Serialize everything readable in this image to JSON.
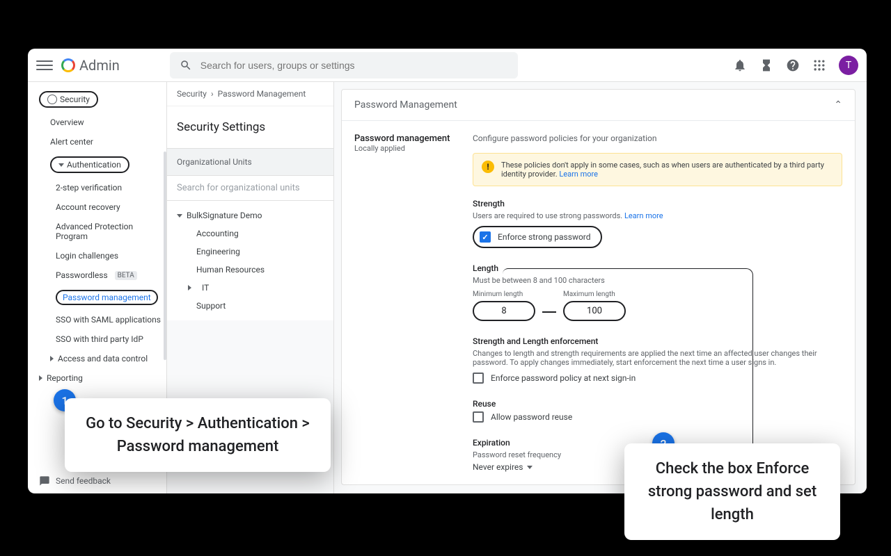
{
  "header": {
    "app_name": "Admin",
    "search_placeholder": "Search for users, groups or settings",
    "avatar_letter": "T"
  },
  "breadcrumb": {
    "root": "Security",
    "current": "Password Management"
  },
  "sidebar": {
    "security": "Security",
    "overview": "Overview",
    "alert_center": "Alert center",
    "authentication": "Authentication",
    "two_step": "2-step verification",
    "account_recovery": "Account recovery",
    "adv_protection": "Advanced Protection Program",
    "login_challenges": "Login challenges",
    "passwordless": "Passwordless",
    "beta": "BETA",
    "password_mgmt": "Password management",
    "sso_saml": "SSO with SAML applications",
    "sso_third": "SSO with third party IdP",
    "access_data": "Access and data control",
    "reporting": "Reporting",
    "send_feedback": "Send feedback"
  },
  "ou": {
    "title": "Security Settings",
    "header": "Organizational Units",
    "search": "Search for organizational units",
    "root": "BulkSignature Demo",
    "items": [
      "Accounting",
      "Engineering",
      "Human Resources",
      "IT",
      "Support"
    ]
  },
  "main": {
    "section": "Password Management",
    "card_title": "Password management",
    "card_sub": "Locally applied",
    "configure": "Configure password policies for your organization",
    "warning": "These policies don't apply in some cases, such as when users are authenticated by a third party identity provider.",
    "learn_more": "Learn more",
    "strength_title": "Strength",
    "strength_sub": "Users are required to use strong passwords.",
    "enforce_strong": "Enforce strong password",
    "length_title": "Length",
    "length_sub": "Must be between 8 and 100 characters",
    "min_label": "Minimum length",
    "max_label": "Maximum length",
    "min_val": "8",
    "max_val": "100",
    "sl_title": "Strength and Length enforcement",
    "sl_sub": "Changes to length and strength requirements are applied the next time an affected user changes their password. To apply changes immediately, start enforcement the next time a user signs in.",
    "enforce_signin": "Enforce password policy at next sign-in",
    "reuse_title": "Reuse",
    "allow_reuse": "Allow password reuse",
    "expiration_title": "Expiration",
    "expiration_sub": "Password reset frequency",
    "expiration_val": "Never expires"
  },
  "callouts": {
    "c1": "Go to Security > Authentication > Password management",
    "c2": "Check the box Enforce strong password and set length"
  }
}
